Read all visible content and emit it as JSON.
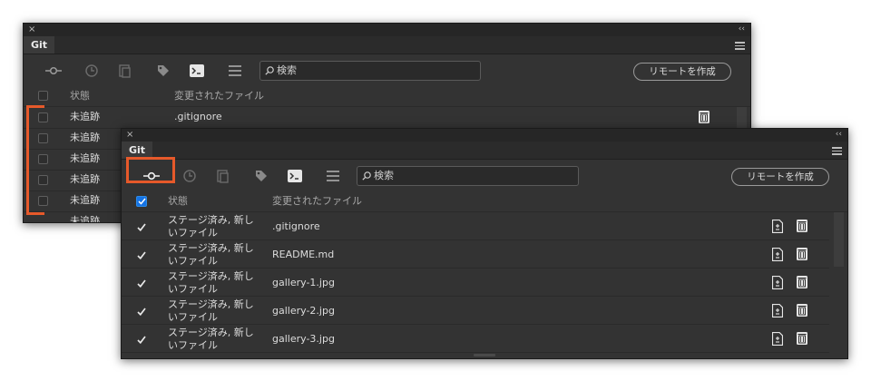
{
  "back_panel": {
    "close_glyph": "×",
    "collapse_glyph": "‹‹",
    "tab_label": "Git",
    "search_placeholder": "検索",
    "remote_button": "リモートを作成",
    "header_status": "状態",
    "header_files": "変更されたファイル",
    "rows": [
      {
        "status": "未追跡",
        "file": ".gitignore"
      },
      {
        "status": "未追跡",
        "file": ""
      },
      {
        "status": "未追跡",
        "file": ""
      },
      {
        "status": "未追跡",
        "file": ""
      },
      {
        "status": "未追跡",
        "file": ""
      }
    ],
    "partial_row_status": "未追跡"
  },
  "front_panel": {
    "close_glyph": "×",
    "collapse_glyph": "‹‹",
    "tab_label": "Git",
    "search_placeholder": "検索",
    "remote_button": "リモートを作成",
    "header_status": "状態",
    "header_files": "変更されたファイル",
    "rows": [
      {
        "status_line1": "ステージ済み, 新し",
        "status_line2": "いファイル",
        "file": ".gitignore"
      },
      {
        "status_line1": "ステージ済み, 新し",
        "status_line2": "いファイル",
        "file": "README.md"
      },
      {
        "status_line1": "ステージ済み, 新し",
        "status_line2": "いファイル",
        "file": "gallery-1.jpg"
      },
      {
        "status_line1": "ステージ済み, 新し",
        "status_line2": "いファイル",
        "file": "gallery-2.jpg"
      },
      {
        "status_line1": "ステージ済み, 新し",
        "status_line2": "いファイル",
        "file": "gallery-3.jpg"
      }
    ]
  },
  "colors": {
    "highlight": "#e6592a",
    "panel_bg": "#333333",
    "accent_blue": "#1473e6"
  },
  "icons": {
    "toolbar": [
      "commit-icon",
      "history-icon",
      "stash-icon",
      "tag-icon",
      "terminal-icon",
      "menu-icon"
    ],
    "row_actions": [
      "diff-file-icon",
      "trash-icon"
    ]
  }
}
